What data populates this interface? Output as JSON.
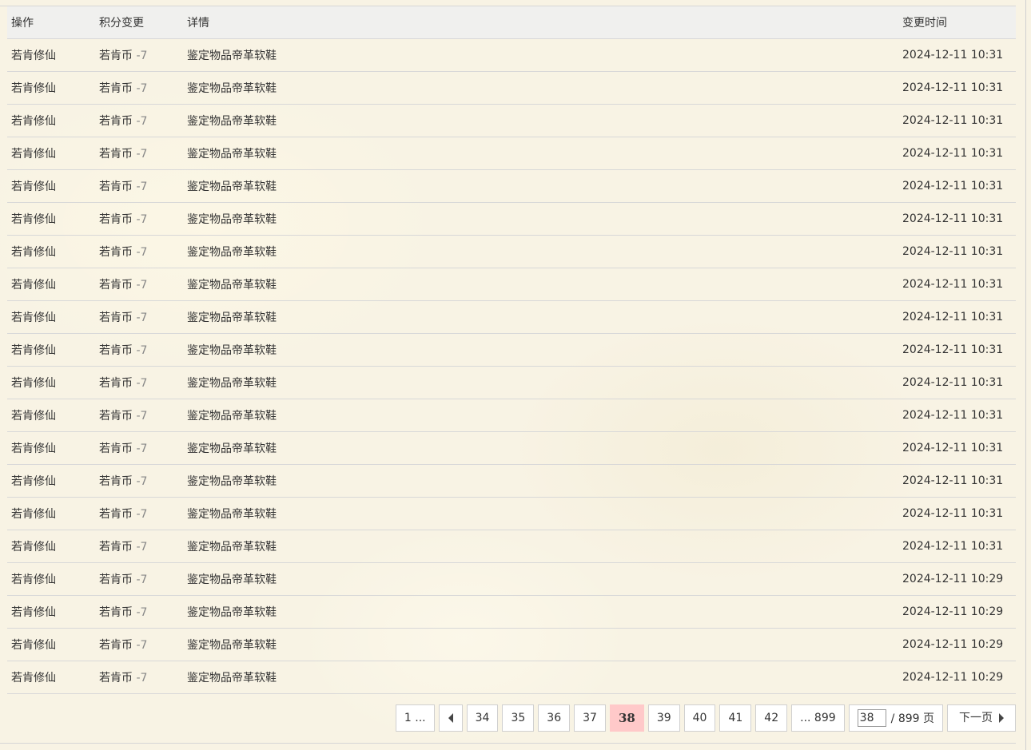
{
  "table": {
    "headers": {
      "operation": "操作",
      "change": "积分变更",
      "detail": "详情",
      "time": "变更时间"
    },
    "rows": [
      {
        "operation": "若肯修仙",
        "currency": "若肯币",
        "amount": "-7",
        "detail": "鉴定物品帝革软鞋",
        "time": "2024-12-11 10:31"
      },
      {
        "operation": "若肯修仙",
        "currency": "若肯币",
        "amount": "-7",
        "detail": "鉴定物品帝革软鞋",
        "time": "2024-12-11 10:31"
      },
      {
        "operation": "若肯修仙",
        "currency": "若肯币",
        "amount": "-7",
        "detail": "鉴定物品帝革软鞋",
        "time": "2024-12-11 10:31"
      },
      {
        "operation": "若肯修仙",
        "currency": "若肯币",
        "amount": "-7",
        "detail": "鉴定物品帝革软鞋",
        "time": "2024-12-11 10:31"
      },
      {
        "operation": "若肯修仙",
        "currency": "若肯币",
        "amount": "-7",
        "detail": "鉴定物品帝革软鞋",
        "time": "2024-12-11 10:31"
      },
      {
        "operation": "若肯修仙",
        "currency": "若肯币",
        "amount": "-7",
        "detail": "鉴定物品帝革软鞋",
        "time": "2024-12-11 10:31"
      },
      {
        "operation": "若肯修仙",
        "currency": "若肯币",
        "amount": "-7",
        "detail": "鉴定物品帝革软鞋",
        "time": "2024-12-11 10:31"
      },
      {
        "operation": "若肯修仙",
        "currency": "若肯币",
        "amount": "-7",
        "detail": "鉴定物品帝革软鞋",
        "time": "2024-12-11 10:31"
      },
      {
        "operation": "若肯修仙",
        "currency": "若肯币",
        "amount": "-7",
        "detail": "鉴定物品帝革软鞋",
        "time": "2024-12-11 10:31"
      },
      {
        "operation": "若肯修仙",
        "currency": "若肯币",
        "amount": "-7",
        "detail": "鉴定物品帝革软鞋",
        "time": "2024-12-11 10:31"
      },
      {
        "operation": "若肯修仙",
        "currency": "若肯币",
        "amount": "-7",
        "detail": "鉴定物品帝革软鞋",
        "time": "2024-12-11 10:31"
      },
      {
        "operation": "若肯修仙",
        "currency": "若肯币",
        "amount": "-7",
        "detail": "鉴定物品帝革软鞋",
        "time": "2024-12-11 10:31"
      },
      {
        "operation": "若肯修仙",
        "currency": "若肯币",
        "amount": "-7",
        "detail": "鉴定物品帝革软鞋",
        "time": "2024-12-11 10:31"
      },
      {
        "operation": "若肯修仙",
        "currency": "若肯币",
        "amount": "-7",
        "detail": "鉴定物品帝革软鞋",
        "time": "2024-12-11 10:31"
      },
      {
        "operation": "若肯修仙",
        "currency": "若肯币",
        "amount": "-7",
        "detail": "鉴定物品帝革软鞋",
        "time": "2024-12-11 10:31"
      },
      {
        "operation": "若肯修仙",
        "currency": "若肯币",
        "amount": "-7",
        "detail": "鉴定物品帝革软鞋",
        "time": "2024-12-11 10:31"
      },
      {
        "operation": "若肯修仙",
        "currency": "若肯币",
        "amount": "-7",
        "detail": "鉴定物品帝革软鞋",
        "time": "2024-12-11 10:29"
      },
      {
        "operation": "若肯修仙",
        "currency": "若肯币",
        "amount": "-7",
        "detail": "鉴定物品帝革软鞋",
        "time": "2024-12-11 10:29"
      },
      {
        "operation": "若肯修仙",
        "currency": "若肯币",
        "amount": "-7",
        "detail": "鉴定物品帝革软鞋",
        "time": "2024-12-11 10:29"
      },
      {
        "operation": "若肯修仙",
        "currency": "若肯币",
        "amount": "-7",
        "detail": "鉴定物品帝革软鞋",
        "time": "2024-12-11 10:29"
      }
    ]
  },
  "pagination": {
    "first": "1 ...",
    "pages": [
      "34",
      "35",
      "36",
      "37",
      "38",
      "39",
      "40",
      "41",
      "42"
    ],
    "current": "38",
    "last": "... 899",
    "jump_value": "38",
    "jump_total": "/ 899 页",
    "next_label": "下一页",
    "prev_icon": "triangle-left-icon",
    "next_icon": "triangle-right-icon"
  },
  "colors": {
    "background": "#f8f3e4",
    "current_page": "#ffc9c9",
    "negative_amount": "#888888"
  }
}
